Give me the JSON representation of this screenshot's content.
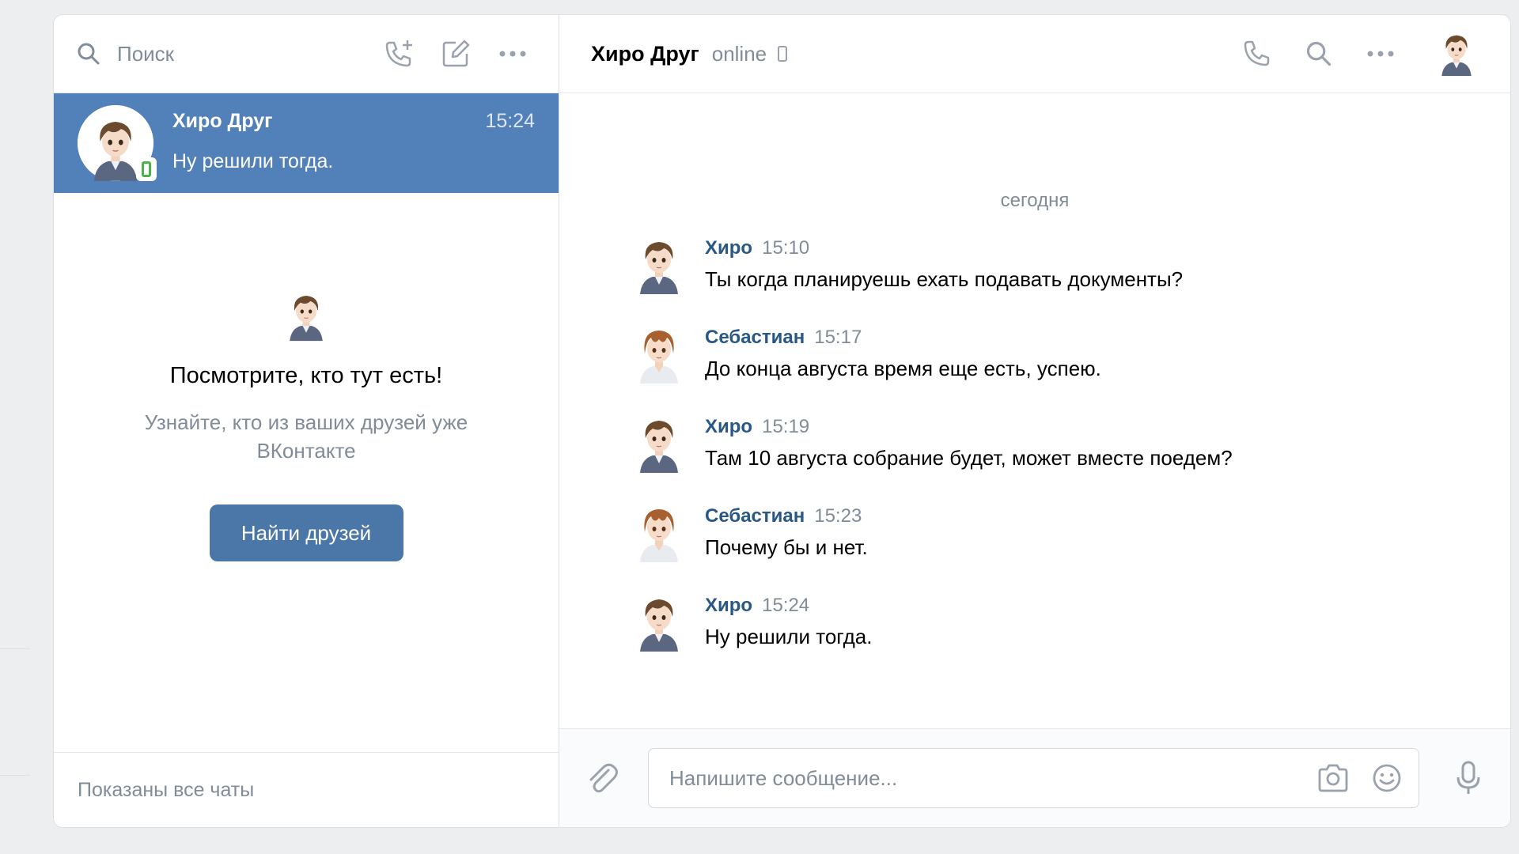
{
  "colors": {
    "accent": "#5181b8",
    "button": "#4a76a8",
    "link": "#2a5885",
    "muted": "#818c99",
    "online": "#4bb34b"
  },
  "chats_panel": {
    "search_placeholder": "Поиск",
    "icons": [
      "call-add-icon",
      "compose-icon",
      "more-icon"
    ],
    "active_chat": {
      "name": "Хиро Друг",
      "time": "15:24",
      "preview": "Ну решили тогда."
    },
    "empty_state": {
      "title": "Посмотрите, кто тут есть!",
      "subtitle": "Узнайте, кто из ваших друзей уже ВКонтакте",
      "button": "Найти друзей"
    },
    "footer": "Показаны все чаты"
  },
  "conversation": {
    "peer_name": "Хиро Друг",
    "peer_status": "online",
    "icons": [
      "phone-icon",
      "search-icon",
      "more-icon"
    ],
    "day_separator": "сегодня",
    "messages": [
      {
        "author": "Хиро",
        "time": "15:10",
        "text": "Ты когда планируешь ехать подавать документы?"
      },
      {
        "author": "Себастиан",
        "time": "15:17",
        "text": "До конца августа время еще есть, успею."
      },
      {
        "author": "Хиро",
        "time": "15:19",
        "text": "Там 10 августа собрание будет, может вместе поедем?"
      },
      {
        "author": "Себастиан",
        "time": "15:23",
        "text": "Почему бы и нет."
      },
      {
        "author": "Хиро",
        "time": "15:24",
        "text": "Ну решили тогда."
      }
    ],
    "composer_placeholder": "Напишите сообщение..."
  }
}
